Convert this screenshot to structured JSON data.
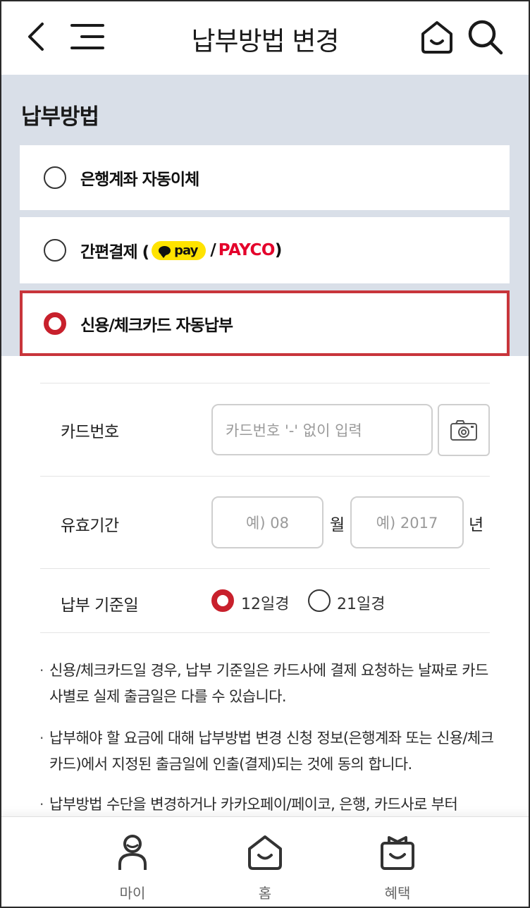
{
  "header": {
    "title": "납부방법 변경",
    "icons": [
      "back-icon",
      "menu-icon",
      "home-icon",
      "search-icon"
    ]
  },
  "section": {
    "title": "납부방법"
  },
  "options": [
    {
      "label": "은행계좌 자동이체",
      "selected": false
    },
    {
      "label_prefix": "간편결제 (",
      "kakao_badge": "pay",
      "separator": " /",
      "payco": "PAYCO",
      "label_suffix": ")",
      "selected": false
    },
    {
      "label": "신용/체크카드 자동납부",
      "selected": true
    }
  ],
  "card_form": {
    "card_number": {
      "label": "카드번호",
      "placeholder": "카드번호 '-' 없이 입력"
    },
    "expiry": {
      "label": "유효기간",
      "month_placeholder": "예) 08",
      "month_unit": "월",
      "year_placeholder": "예) 2017",
      "year_unit": "년"
    },
    "billing_day": {
      "label": "납부 기준일",
      "options": [
        {
          "label": "12일경",
          "selected": true
        },
        {
          "label": "21일경",
          "selected": false
        }
      ]
    }
  },
  "notes": [
    "신용/체크카드일 경우, 납부 기준일은 카드사에 결제 요청하는 날짜로 카드사별로 실제 출금일은 다를 수 있습니다.",
    "납부해야 할 요금에 대해 납부방법 변경 신청 정보(은행계좌 또는 신용/체크카드)에서 지정된 출금일에 인출(결제)되는 것에 동의 합니다.",
    "납부방법 수단을 변경하거나 카카오페이/페이코, 은행, 카드사로 부터"
  ],
  "bottom_nav": [
    {
      "label": "마이",
      "icon": "person-icon"
    },
    {
      "label": "홈",
      "icon": "home-icon"
    },
    {
      "label": "혜택",
      "icon": "gift-icon"
    }
  ],
  "colors": {
    "accent": "#c8202c",
    "background": "#d9dfe8",
    "kakao": "#ffe300",
    "payco": "#e4002b"
  }
}
